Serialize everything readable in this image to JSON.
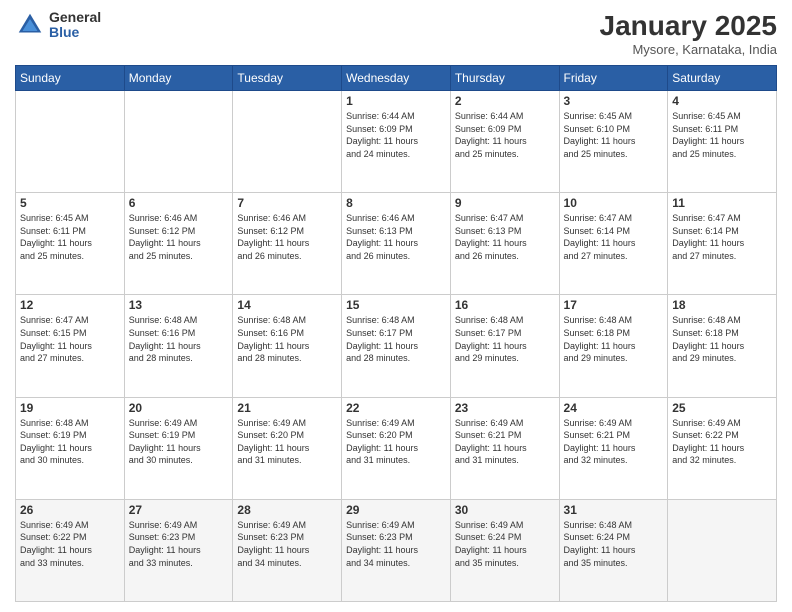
{
  "logo": {
    "general": "General",
    "blue": "Blue"
  },
  "title": {
    "month": "January 2025",
    "location": "Mysore, Karnataka, India"
  },
  "weekdays": [
    "Sunday",
    "Monday",
    "Tuesday",
    "Wednesday",
    "Thursday",
    "Friday",
    "Saturday"
  ],
  "weeks": [
    [
      {
        "day": "",
        "text": ""
      },
      {
        "day": "",
        "text": ""
      },
      {
        "day": "",
        "text": ""
      },
      {
        "day": "1",
        "text": "Sunrise: 6:44 AM\nSunset: 6:09 PM\nDaylight: 11 hours\nand 24 minutes."
      },
      {
        "day": "2",
        "text": "Sunrise: 6:44 AM\nSunset: 6:09 PM\nDaylight: 11 hours\nand 25 minutes."
      },
      {
        "day": "3",
        "text": "Sunrise: 6:45 AM\nSunset: 6:10 PM\nDaylight: 11 hours\nand 25 minutes."
      },
      {
        "day": "4",
        "text": "Sunrise: 6:45 AM\nSunset: 6:11 PM\nDaylight: 11 hours\nand 25 minutes."
      }
    ],
    [
      {
        "day": "5",
        "text": "Sunrise: 6:45 AM\nSunset: 6:11 PM\nDaylight: 11 hours\nand 25 minutes."
      },
      {
        "day": "6",
        "text": "Sunrise: 6:46 AM\nSunset: 6:12 PM\nDaylight: 11 hours\nand 25 minutes."
      },
      {
        "day": "7",
        "text": "Sunrise: 6:46 AM\nSunset: 6:12 PM\nDaylight: 11 hours\nand 26 minutes."
      },
      {
        "day": "8",
        "text": "Sunrise: 6:46 AM\nSunset: 6:13 PM\nDaylight: 11 hours\nand 26 minutes."
      },
      {
        "day": "9",
        "text": "Sunrise: 6:47 AM\nSunset: 6:13 PM\nDaylight: 11 hours\nand 26 minutes."
      },
      {
        "day": "10",
        "text": "Sunrise: 6:47 AM\nSunset: 6:14 PM\nDaylight: 11 hours\nand 27 minutes."
      },
      {
        "day": "11",
        "text": "Sunrise: 6:47 AM\nSunset: 6:14 PM\nDaylight: 11 hours\nand 27 minutes."
      }
    ],
    [
      {
        "day": "12",
        "text": "Sunrise: 6:47 AM\nSunset: 6:15 PM\nDaylight: 11 hours\nand 27 minutes."
      },
      {
        "day": "13",
        "text": "Sunrise: 6:48 AM\nSunset: 6:16 PM\nDaylight: 11 hours\nand 28 minutes."
      },
      {
        "day": "14",
        "text": "Sunrise: 6:48 AM\nSunset: 6:16 PM\nDaylight: 11 hours\nand 28 minutes."
      },
      {
        "day": "15",
        "text": "Sunrise: 6:48 AM\nSunset: 6:17 PM\nDaylight: 11 hours\nand 28 minutes."
      },
      {
        "day": "16",
        "text": "Sunrise: 6:48 AM\nSunset: 6:17 PM\nDaylight: 11 hours\nand 29 minutes."
      },
      {
        "day": "17",
        "text": "Sunrise: 6:48 AM\nSunset: 6:18 PM\nDaylight: 11 hours\nand 29 minutes."
      },
      {
        "day": "18",
        "text": "Sunrise: 6:48 AM\nSunset: 6:18 PM\nDaylight: 11 hours\nand 29 minutes."
      }
    ],
    [
      {
        "day": "19",
        "text": "Sunrise: 6:48 AM\nSunset: 6:19 PM\nDaylight: 11 hours\nand 30 minutes."
      },
      {
        "day": "20",
        "text": "Sunrise: 6:49 AM\nSunset: 6:19 PM\nDaylight: 11 hours\nand 30 minutes."
      },
      {
        "day": "21",
        "text": "Sunrise: 6:49 AM\nSunset: 6:20 PM\nDaylight: 11 hours\nand 31 minutes."
      },
      {
        "day": "22",
        "text": "Sunrise: 6:49 AM\nSunset: 6:20 PM\nDaylight: 11 hours\nand 31 minutes."
      },
      {
        "day": "23",
        "text": "Sunrise: 6:49 AM\nSunset: 6:21 PM\nDaylight: 11 hours\nand 31 minutes."
      },
      {
        "day": "24",
        "text": "Sunrise: 6:49 AM\nSunset: 6:21 PM\nDaylight: 11 hours\nand 32 minutes."
      },
      {
        "day": "25",
        "text": "Sunrise: 6:49 AM\nSunset: 6:22 PM\nDaylight: 11 hours\nand 32 minutes."
      }
    ],
    [
      {
        "day": "26",
        "text": "Sunrise: 6:49 AM\nSunset: 6:22 PM\nDaylight: 11 hours\nand 33 minutes."
      },
      {
        "day": "27",
        "text": "Sunrise: 6:49 AM\nSunset: 6:23 PM\nDaylight: 11 hours\nand 33 minutes."
      },
      {
        "day": "28",
        "text": "Sunrise: 6:49 AM\nSunset: 6:23 PM\nDaylight: 11 hours\nand 34 minutes."
      },
      {
        "day": "29",
        "text": "Sunrise: 6:49 AM\nSunset: 6:23 PM\nDaylight: 11 hours\nand 34 minutes."
      },
      {
        "day": "30",
        "text": "Sunrise: 6:49 AM\nSunset: 6:24 PM\nDaylight: 11 hours\nand 35 minutes."
      },
      {
        "day": "31",
        "text": "Sunrise: 6:48 AM\nSunset: 6:24 PM\nDaylight: 11 hours\nand 35 minutes."
      },
      {
        "day": "",
        "text": ""
      }
    ]
  ]
}
